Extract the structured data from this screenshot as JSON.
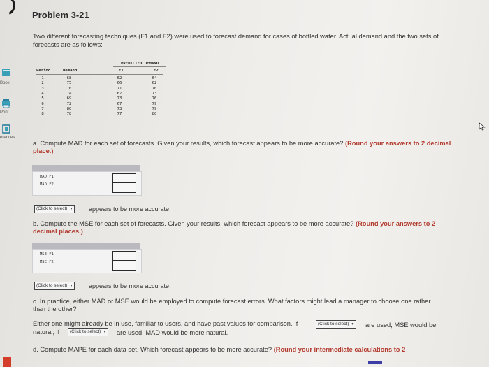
{
  "sidebar": {
    "items": [
      {
        "label": "Book",
        "icon": "book-icon"
      },
      {
        "label": "Print",
        "icon": "print-icon"
      },
      {
        "label": "erences",
        "icon": "references-icon"
      }
    ]
  },
  "problem": {
    "title": "Problem 3-21",
    "intro": "Two different forecasting techniques (F1 and F2) were used to forecast demand for cases of bottled water. Actual demand and the two sets of forecasts are as follows:"
  },
  "table": {
    "group_header": "PREDICTED DEMAND",
    "headers": [
      "Period",
      "Demand",
      "F1",
      "F2"
    ],
    "rows": [
      [
        "1",
        "68",
        "62",
        "64"
      ],
      [
        "2",
        "75",
        "66",
        "62"
      ],
      [
        "3",
        "70",
        "71",
        "70"
      ],
      [
        "4",
        "74",
        "67",
        "73"
      ],
      [
        "5",
        "69",
        "73",
        "76"
      ],
      [
        "6",
        "72",
        "67",
        "79"
      ],
      [
        "7",
        "80",
        "73",
        "79"
      ],
      [
        "8",
        "78",
        "77",
        "80"
      ]
    ]
  },
  "part_a": {
    "question": "a. Compute MAD for each set of forecasts. Given your results, which forecast appears to be more accurate?",
    "instruction": "(Round your answers to 2 decimal place.)",
    "rows": [
      "MAD F1",
      "MAD F2"
    ],
    "select_label": "(Click to select)",
    "after_select": "appears to be more accurate."
  },
  "part_b": {
    "question": "b. Compute the MSE for each set of forecasts. Given your results, which forecast appears to be more accurate?",
    "instruction": "(Round your answers to 2 decimal places.)",
    "rows": [
      "MSE F1",
      "MSE F2"
    ],
    "select_label": "(Click to select)",
    "after_select": "appears to be more accurate."
  },
  "part_c": {
    "question": "c. In practice, either MAD or MSE would be employed to compute forecast errors. What factors might lead a manager to choose one rather than the other?",
    "sentence_part1": "Either one might already be in use, familiar to users, and have past values for comparison. If",
    "select1_label": "(Click to select)",
    "sentence_part2": "are used, MSE would be",
    "sentence_part3": "natural; if",
    "select2_label": "(Click to select)",
    "sentence_part4": "are used, MAD would be more natural."
  },
  "part_d": {
    "question": "d. Compute MAPE for each data set. Which forecast appears to be more accurate?",
    "instruction": "(Round your intermediate calculations to 2"
  },
  "colors": {
    "accent_red": "#b23a2e",
    "band_gray": "#b9b9bf"
  }
}
